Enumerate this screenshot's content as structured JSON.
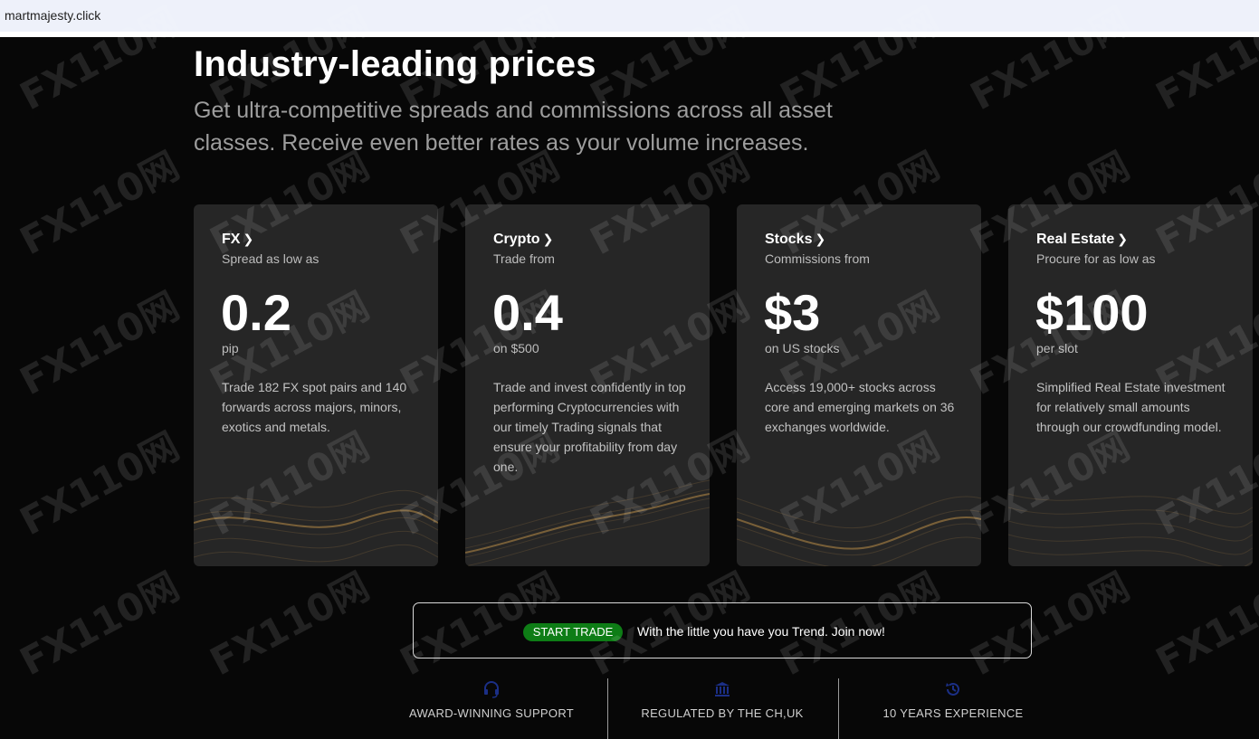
{
  "browser": {
    "url": "martmajesty.click"
  },
  "hero": {
    "title": "Industry-leading prices",
    "subtitle": "Get ultra-competitive spreads and commissions across all asset classes. Receive even better rates as your volume increases."
  },
  "cards": [
    {
      "name": "FX",
      "pre": "Spread as low as",
      "value": "0.2",
      "unit": "pip",
      "desc": "Trade 182 FX spot pairs and 140 forwards across majors, minors, exotics and metals."
    },
    {
      "name": "Crypto",
      "pre": "Trade from",
      "value": "0.4",
      "unit": "on $500",
      "desc": "Trade and invest confidently in top performing Cryptocurrencies with our timely Trading signals that ensure your profitability from day one."
    },
    {
      "name": "Stocks",
      "pre": "Commissions from",
      "value": "$3",
      "unit": "on US stocks",
      "desc": "Access 19,000+ stocks across core and emerging markets on 36 exchanges worldwide."
    },
    {
      "name": "Real Estate",
      "pre": "Procure for as low as",
      "value": "$100",
      "unit": "per slot",
      "desc": "Simplified Real Estate investment for relatively small amounts through our crowdfunding model."
    }
  ],
  "cta": {
    "button": "START TRADE",
    "message": "With the little you have you Trend. Join now!"
  },
  "features": [
    {
      "label": "AWARD-WINNING SUPPORT",
      "icon": "headset-icon"
    },
    {
      "label": "REGULATED BY THE CH,UK",
      "icon": "bank-icon"
    },
    {
      "label": "10 YEARS EXPERIENCE",
      "icon": "history-icon"
    }
  ],
  "watermark": {
    "text": "FX110网"
  },
  "colors": {
    "background": "#070707",
    "card": "#262626",
    "accent_green": "#0e7d16",
    "wave": "#8a6a3a",
    "icon_blue": "#1b2f86"
  }
}
